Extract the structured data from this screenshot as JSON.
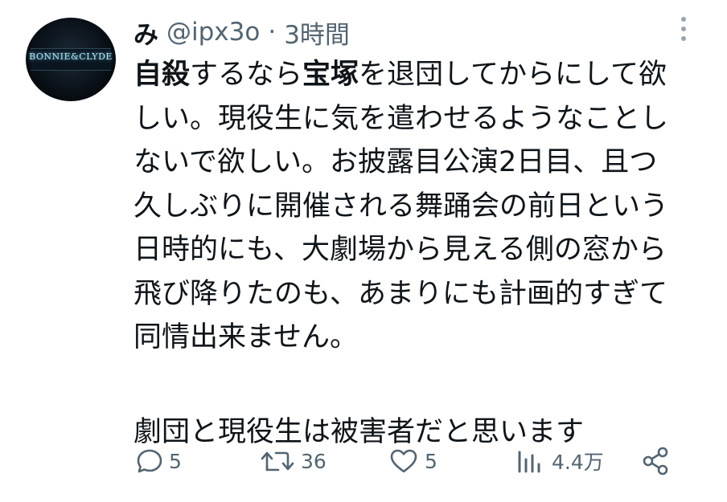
{
  "author": {
    "name": "み",
    "handle": "@ipx3o",
    "separator": "·",
    "time": "3時間",
    "avatar_text": "BONNIE&CLYDE"
  },
  "tweet": {
    "lines": [
      {
        "a": "自殺",
        "b": "するなら",
        "c": "宝塚",
        "d": "を退団してからにして欲"
      },
      {
        "text": "しい。現役生に気を遣わせるようなことし"
      },
      {
        "text": "ないで欲しい。お披露目公演2日目、且つ"
      },
      {
        "text": "久しぶりに開催される舞踊会の前日という"
      },
      {
        "text": "日時的にも、大劇場から見える側の窓から"
      },
      {
        "text": "飛び降りたのも、あまりにも計画的すぎて"
      },
      {
        "text": "同情出来ません。"
      },
      {
        "text": "劇団と現役生は被害者だと思います"
      }
    ]
  },
  "actions": {
    "reply_count": "5",
    "retweet_count": "36",
    "like_count": "5",
    "views_count": "4.4万"
  },
  "icons": {
    "reply": "reply-icon",
    "retweet": "retweet-icon",
    "like": "heart-icon",
    "views": "views-icon",
    "share": "share-icon",
    "more": "more-options-icon"
  },
  "colors": {
    "text": "#0f1419",
    "secondary": "#536471"
  }
}
